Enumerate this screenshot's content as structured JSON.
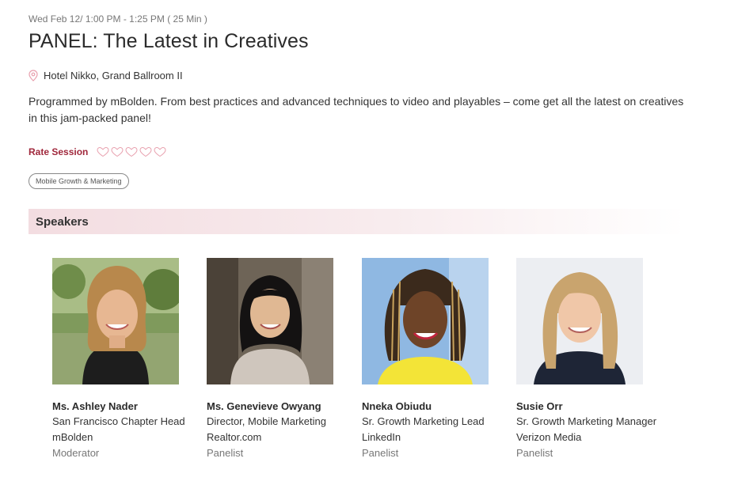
{
  "session": {
    "datetime": "Wed Feb 12/ 1:00 PM - 1:25 PM  ( 25 Min )",
    "title": "PANEL: The Latest in Creatives",
    "location": "Hotel Nikko, Grand Ballroom II",
    "description": "Programmed by mBolden. From best practices and advanced techniques to video and playables – come get all the latest on creatives in this jam-packed panel!",
    "rate_label": "Rate Session",
    "rating": 0,
    "rating_max": 5,
    "tag": "Mobile Growth & Marketing",
    "accent_color": "#a0283c"
  },
  "speakers_section": {
    "title": "Speakers",
    "speakers": [
      {
        "name": "Ms. Ashley Nader",
        "title": "San Francisco Chapter Head",
        "company": "mBolden",
        "role": "Moderator"
      },
      {
        "name": "Ms. Genevieve Owyang",
        "title": "Director, Mobile Marketing",
        "company": "Realtor.com",
        "role": "Panelist"
      },
      {
        "name": "Nneka Obiudu",
        "title": "Sr. Growth Marketing Lead",
        "company": "LinkedIn",
        "role": "Panelist"
      },
      {
        "name": "Susie Orr",
        "title": "Sr. Growth Marketing Manager",
        "company": "Verizon Media",
        "role": "Panelist"
      }
    ]
  }
}
